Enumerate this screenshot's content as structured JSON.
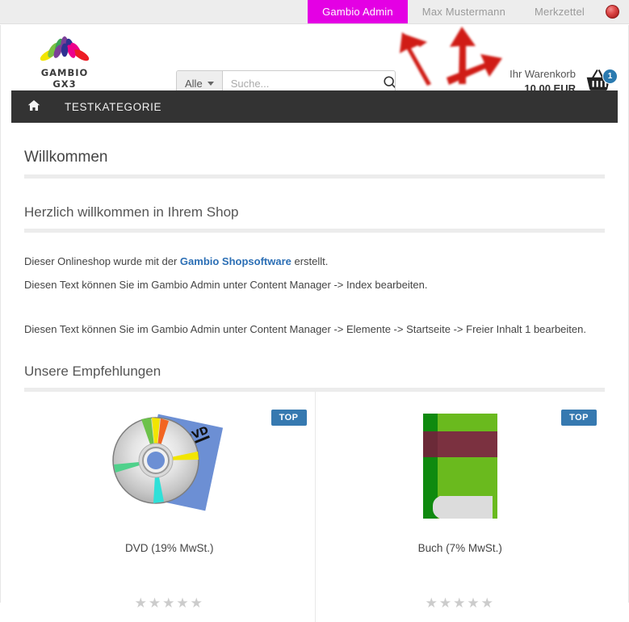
{
  "topbar": {
    "items": [
      {
        "label": "Gambio Admin",
        "active": true
      },
      {
        "label": "Max Mustermann",
        "active": false
      },
      {
        "label": "Merkzettel",
        "active": false
      }
    ],
    "flag_icon": "red-circle-flag-icon",
    "active_color": "#e400e4",
    "background": "#ededed"
  },
  "header": {
    "logo": {
      "text": "GAMBIO GX3",
      "icon": "lotus-flower-logo-icon"
    },
    "search": {
      "category_label": "Alle",
      "placeholder": "Suche...",
      "value": "",
      "search_icon": "magnifier-icon",
      "caret_icon": "chevron-down-icon"
    },
    "cart": {
      "label": "Ihr Warenkorb",
      "total": "10,00 EUR",
      "count": "1",
      "icon": "shopping-basket-icon",
      "badge_color": "#2a7ab0"
    }
  },
  "nav": {
    "home_icon": "home-icon",
    "items": [
      {
        "label": "TESTKATEGORIE"
      }
    ],
    "background": "#333333"
  },
  "main": {
    "heading_welcome": "Willkommen",
    "heading_shop": "Herzlich willkommen in Ihrem Shop",
    "para1_prefix": "Dieser Onlineshop wurde mit der ",
    "para1_link": "Gambio Shopsoftware",
    "para1_suffix": " erstellt.",
    "para2": "Diesen Text können Sie im Gambio Admin unter Content Manager -> Index bearbeiten.",
    "para3": "Diesen Text können Sie im Gambio Admin unter Content Manager -> Elemente -> Startseite -> Freier Inhalt 1 bearbeiten.",
    "heading_recommendations": "Unsere Empfehlungen",
    "link_color": "#2c6fb5"
  },
  "products": [
    {
      "name": "DVD (19% MwSt.)",
      "badge": "TOP",
      "image_icon": "dvd-disc-icon",
      "rating": "★★★★★",
      "rating_value": 0
    },
    {
      "name": "Buch (7% MwSt.)",
      "badge": "TOP",
      "image_icon": "green-book-icon",
      "rating": "★★★★★",
      "rating_value": 0
    }
  ],
  "annotations": {
    "arrow_color": "#d01a16",
    "arrows": [
      {
        "name": "arrow-up-left",
        "points_to": "search-field"
      },
      {
        "name": "arrow-up",
        "points_to": "gambio-admin-tab"
      },
      {
        "name": "arrow-right",
        "points_to": "cart"
      }
    ]
  }
}
